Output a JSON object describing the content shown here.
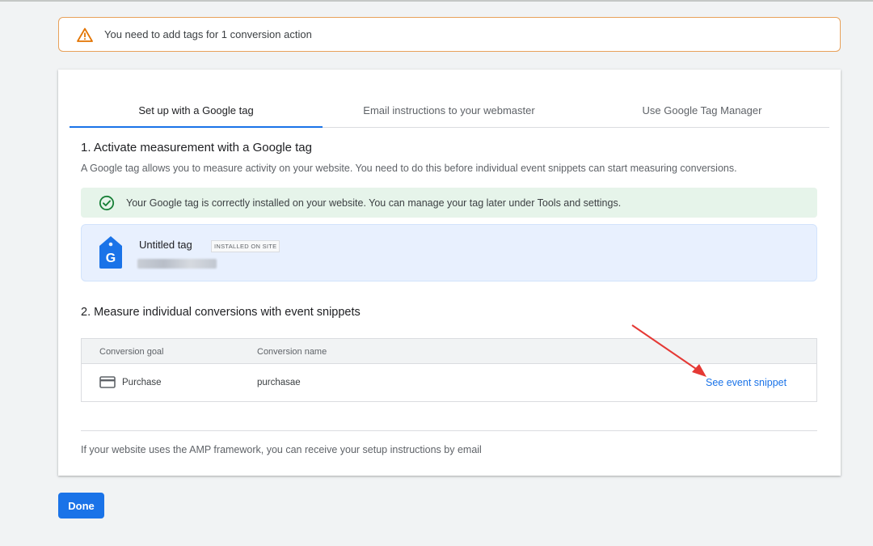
{
  "alert": {
    "text": "You need to add tags for 1 conversion action",
    "icon": "warning-icon"
  },
  "tabs": [
    {
      "label": "Set up with a Google tag",
      "active": true
    },
    {
      "label": "Email instructions to your webmaster",
      "active": false
    },
    {
      "label": "Use Google Tag Manager",
      "active": false
    }
  ],
  "section1": {
    "title": "1. Activate measurement with a Google tag",
    "description": "A Google tag allows you to measure activity on your website. You need to do this before individual event snippets can start measuring conversions.",
    "success_text": "Your Google tag is correctly installed on your website. You can manage your tag later under Tools and settings.",
    "tag": {
      "name": "Untitled tag",
      "badge": "INSTALLED ON SITE",
      "icon_letter": "G"
    }
  },
  "section2": {
    "title": "2. Measure individual conversions with event snippets",
    "columns": [
      "Conversion goal",
      "Conversion name"
    ],
    "rows": [
      {
        "goal": "Purchase",
        "name": "purchasae",
        "action": "See event snippet"
      }
    ]
  },
  "footer_text": "If your website uses the AMP framework, you can receive your setup instructions by email",
  "done_label": "Done",
  "colors": {
    "accent": "#1a73e8",
    "success_bg": "#e6f4ea",
    "warning": "#e37400",
    "annotation_arrow": "#e53935"
  }
}
